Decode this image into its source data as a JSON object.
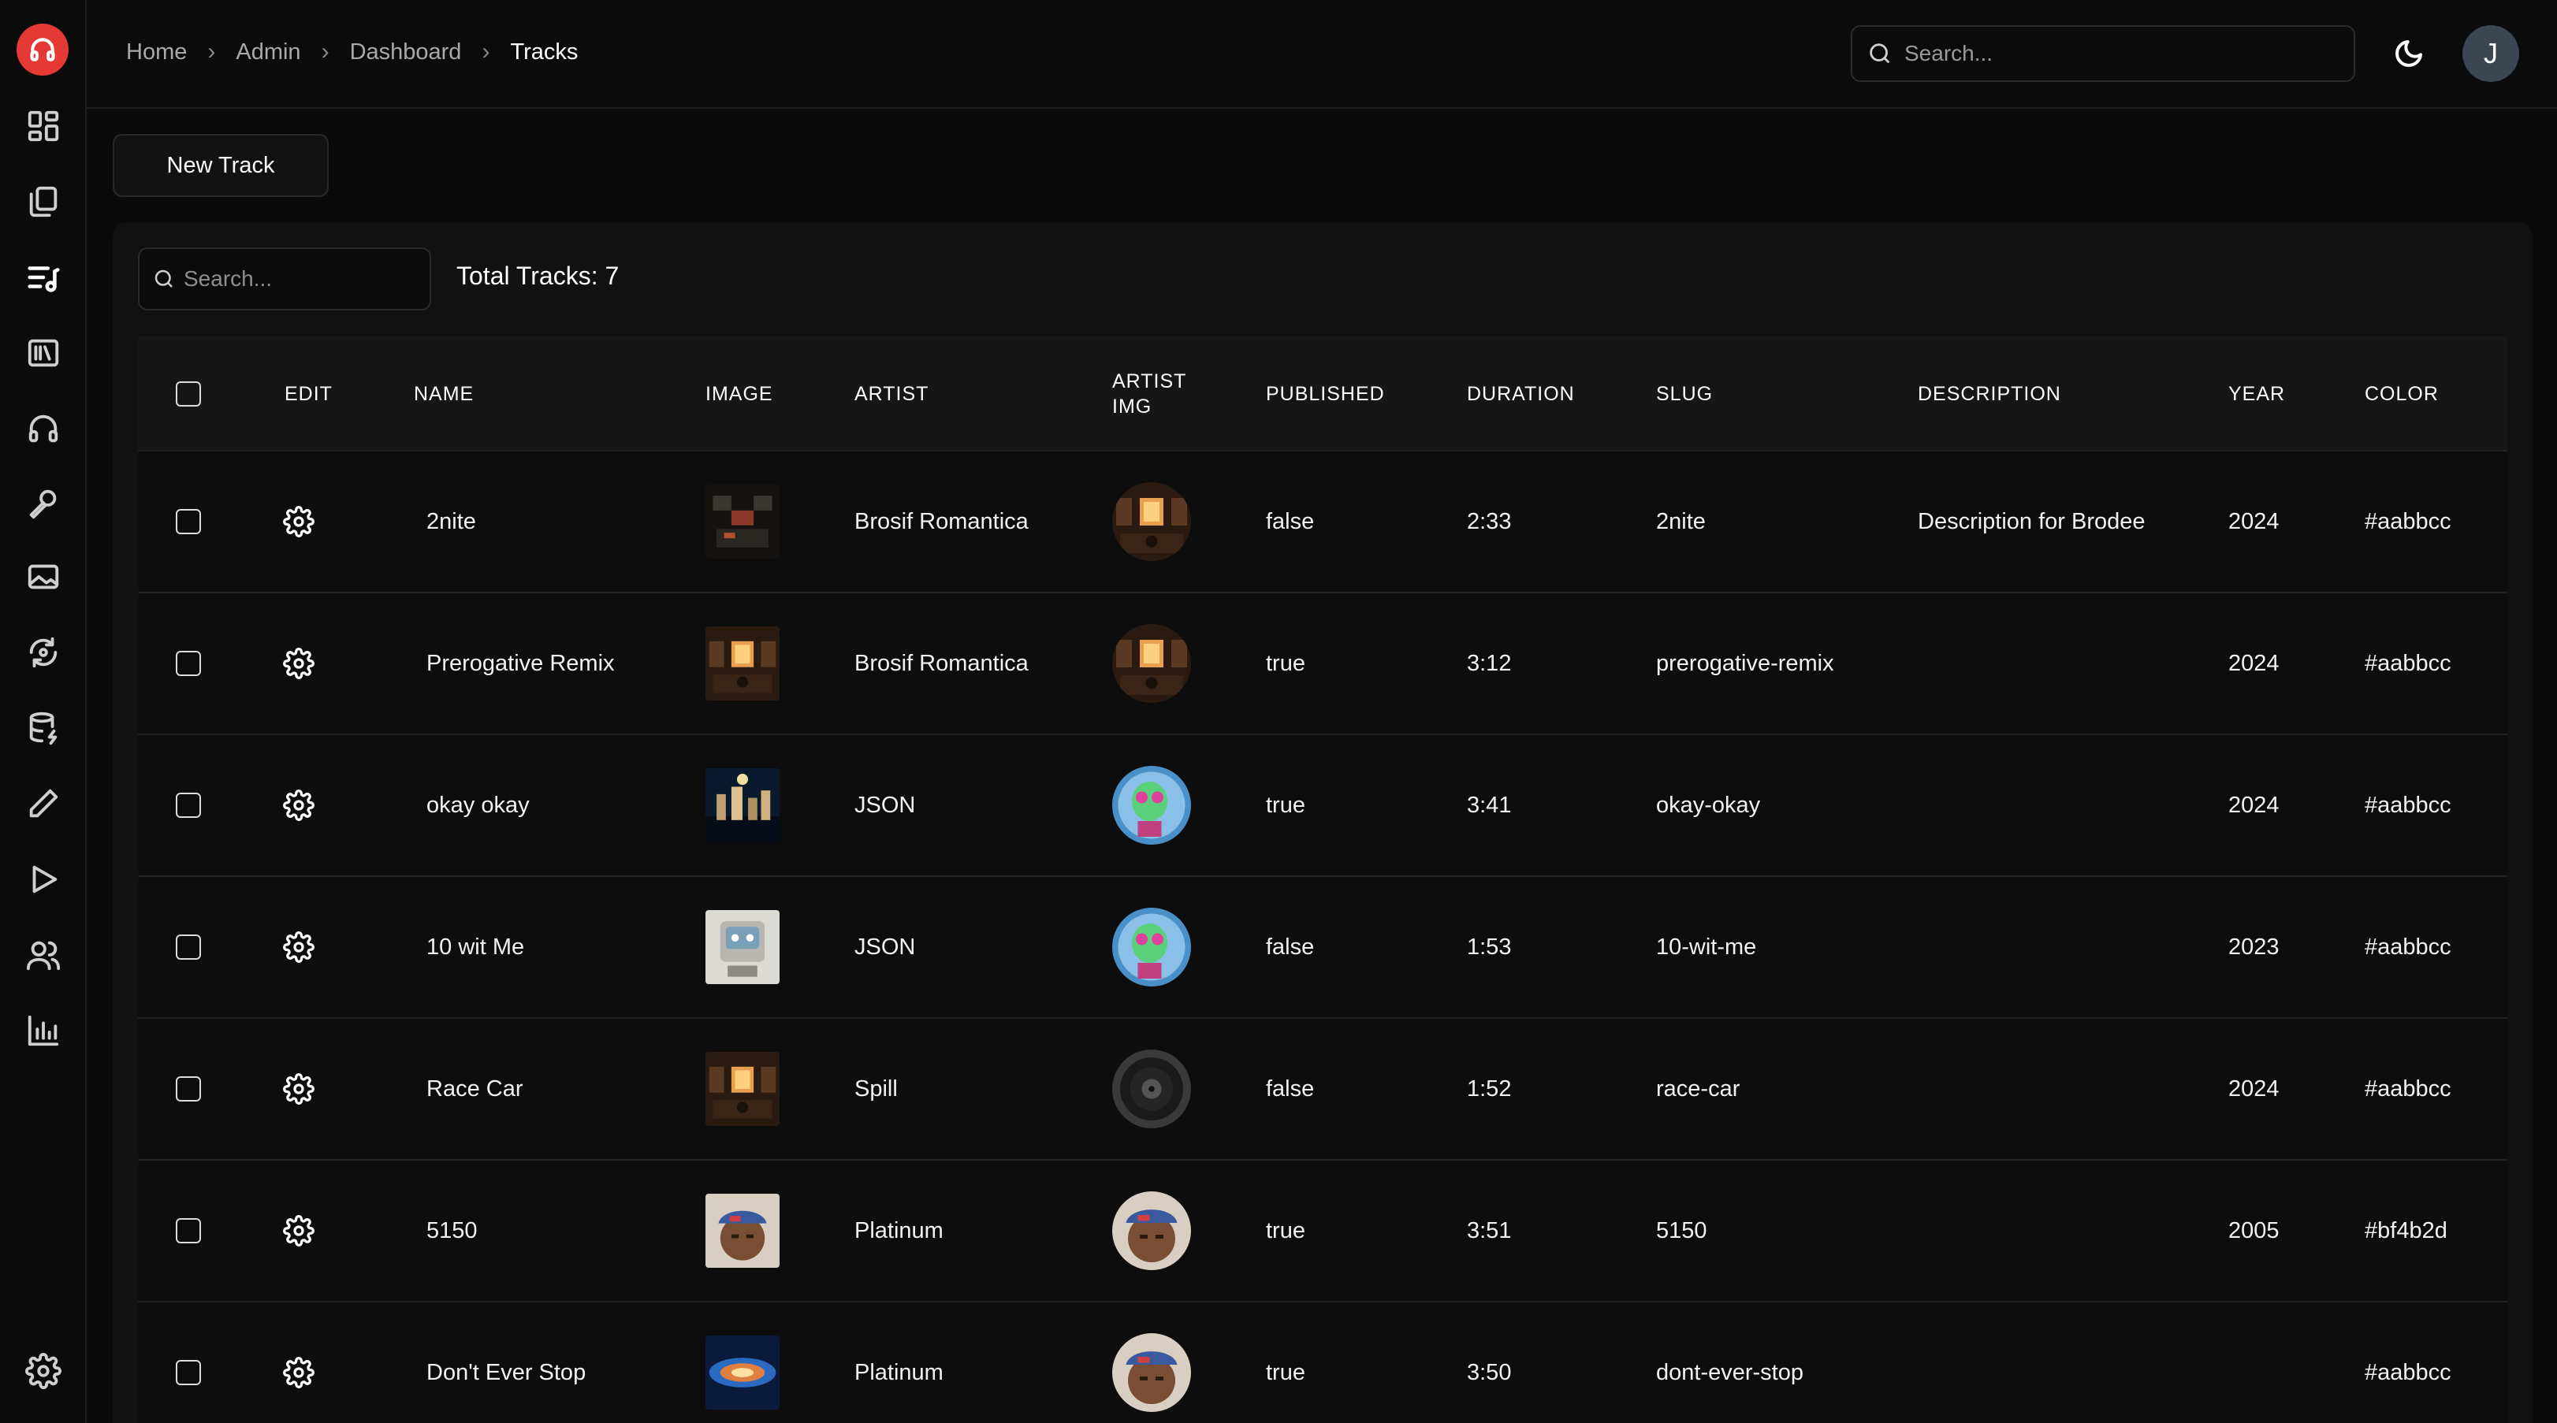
{
  "breadcrumb": [
    {
      "label": "Home"
    },
    {
      "label": "Admin"
    },
    {
      "label": "Dashboard"
    },
    {
      "label": "Tracks",
      "current": true
    }
  ],
  "header": {
    "search_placeholder": "Search...",
    "avatar_initial": "J"
  },
  "sidebar": {
    "brand_icon": "headphones-logo-icon",
    "items": [
      {
        "icon": "dashboard-grid-icon"
      },
      {
        "icon": "copy-pages-icon"
      },
      {
        "icon": "tracks-list-music-icon",
        "active": true
      },
      {
        "icon": "library-icon"
      },
      {
        "icon": "headphones-icon"
      },
      {
        "icon": "microphone-icon"
      },
      {
        "icon": "image-icon"
      },
      {
        "icon": "refresh-cycle-icon"
      },
      {
        "icon": "database-icon"
      },
      {
        "icon": "pencil-icon"
      },
      {
        "icon": "play-icon"
      },
      {
        "icon": "users-icon"
      },
      {
        "icon": "bar-chart-icon"
      }
    ],
    "bottom_icon": "settings-gear-icon"
  },
  "toolbar": {
    "new_track_label": "New Track"
  },
  "table": {
    "search_placeholder": "Search...",
    "total_label": "Total Tracks: 7",
    "columns": [
      "EDIT",
      "NAME",
      "IMAGE",
      "ARTIST",
      "ARTIST IMG",
      "PUBLISHED",
      "DURATION",
      "SLUG",
      "DESCRIPTION",
      "YEAR",
      "COLOR"
    ],
    "rows": [
      {
        "name": "2nite",
        "image": "studio-dark-art",
        "artist": "Brosif Romantica",
        "artist_img": "studio-warm-art",
        "published": "false",
        "duration": "2:33",
        "slug": "2nite",
        "description": "Description for Brodee",
        "year": "2024",
        "color": "#aabbcc"
      },
      {
        "name": "Prerogative Remix",
        "image": "studio-warm-art",
        "artist": "Brosif Romantica",
        "artist_img": "studio-warm-art",
        "published": "true",
        "duration": "3:12",
        "slug": "prerogative-remix",
        "description": "",
        "year": "2024",
        "color": "#aabbcc"
      },
      {
        "name": "okay okay",
        "image": "city-night-art",
        "artist": "JSON",
        "artist_img": "alien-avatar-art",
        "published": "true",
        "duration": "3:41",
        "slug": "okay-okay",
        "description": "",
        "year": "2024",
        "color": "#aabbcc"
      },
      {
        "name": "10 wit Me",
        "image": "robot-box-art",
        "artist": "JSON",
        "artist_img": "alien-avatar-art",
        "published": "false",
        "duration": "1:53",
        "slug": "10-wit-me",
        "description": "",
        "year": "2023",
        "color": "#aabbcc"
      },
      {
        "name": "Race Car",
        "image": "studio-warm-art",
        "artist": "Spill",
        "artist_img": "vinyl-record-art",
        "published": "false",
        "duration": "1:52",
        "slug": "race-car",
        "description": "",
        "year": "2024",
        "color": "#aabbcc"
      },
      {
        "name": "5150",
        "image": "portrait-cap-art",
        "artist": "Platinum",
        "artist_img": "portrait-cap-art",
        "published": "true",
        "duration": "3:51",
        "slug": "5150",
        "description": "",
        "year": "2005",
        "color": "#bf4b2d"
      },
      {
        "name": "Don't Ever Stop",
        "image": "swirl-blue-art",
        "artist": "Platinum",
        "artist_img": "portrait-cap-art",
        "published": "true",
        "duration": "3:50",
        "slug": "dont-ever-stop",
        "description": "",
        "year": "",
        "color": "#aabbcc"
      }
    ]
  },
  "colors": {
    "brand": "#e53935",
    "background": "#0a0a0a",
    "panel": "#111111",
    "border": "#222222",
    "avatar_bg": "#3b4652"
  }
}
